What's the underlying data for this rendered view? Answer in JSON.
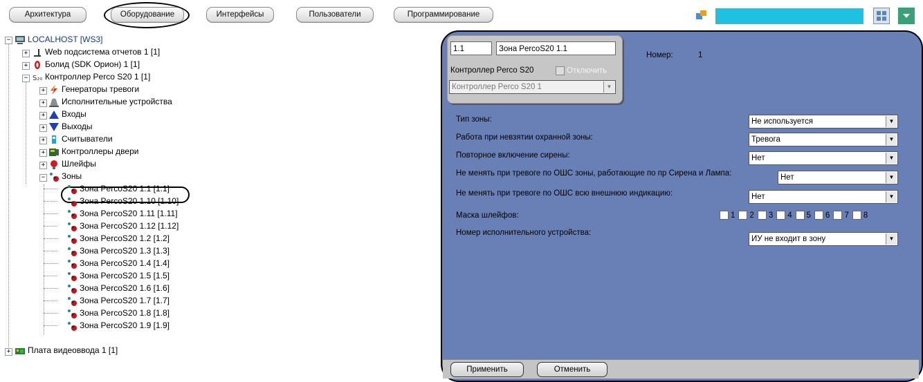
{
  "toolbar": {
    "tabs": [
      "Архитектура",
      "Оборудование",
      "Интерфейсы",
      "Пользователи",
      "Программирование"
    ]
  },
  "tree": {
    "root": "LOCALHOST [WS3]",
    "items": [
      {
        "label": "Web подсистема отчетов 1 [1]",
        "icon": "report-icon"
      },
      {
        "label": "Болид (SDK Орион) 1 [1]",
        "icon": "bolid-icon"
      },
      {
        "label": "Контроллер Perco S20 1 [1]",
        "icon": "controller-icon"
      },
      {
        "label": "Генераторы тревоги",
        "icon": "lightning-icon"
      },
      {
        "label": "Исполнительные устройства",
        "icon": "siren-icon"
      },
      {
        "label": "Входы",
        "icon": "input-icon"
      },
      {
        "label": "Выходы",
        "icon": "output-icon"
      },
      {
        "label": "Считыватели",
        "icon": "reader-icon"
      },
      {
        "label": "Контроллеры двери",
        "icon": "door-controller-icon"
      },
      {
        "label": "Шлейфы",
        "icon": "loop-icon"
      },
      {
        "label": "Зоны",
        "icon": "zones-icon"
      }
    ],
    "zones": [
      "Зона PercoS20 1.1 [1.1]",
      "Зона PercoS20 1.10 [1.10]",
      "Зона PercoS20 1.11 [1.11]",
      "Зона PercoS20 1.12 [1.12]",
      "Зона PercoS20 1.2 [1.2]",
      "Зона PercoS20 1.3 [1.3]",
      "Зона PercoS20 1.4 [1.4]",
      "Зона PercoS20 1.5 [1.5]",
      "Зона PercoS20 1.6 [1.6]",
      "Зона PercoS20 1.7 [1.7]",
      "Зона PercoS20 1.8 [1.8]",
      "Зона PercoS20 1.9 [1.9]"
    ],
    "last": "Плата видеоввода 1 [1]"
  },
  "header": {
    "id_value": "1.1",
    "name_value": "Зона PercoS20 1.1",
    "number_label": "Номер:",
    "number_value": "1",
    "parent_label": "Контроллер Perco S20",
    "disable_label": "Отключить",
    "parent_select": "Контроллер Perco S20 1"
  },
  "settings": {
    "zone_type_label": "Тип зоны:",
    "zone_type_value": "Не используется",
    "unarmed_label": "Работа при невзятии охранной зоны:",
    "unarmed_value": "Тревога",
    "siren_label": "Повторное включение сирены:",
    "siren_value": "Нет",
    "no_change_siren_label": "Не менять при тревоге по ОШС зоны, работающие по пр Сирена и Лампа:",
    "no_change_siren_value": "Нет",
    "no_change_ind_label": "Не менять при тревоге по ОШС всю внешнюю индикацию:",
    "no_change_ind_value": "Нет",
    "loops_label": "Маска шлейфов:",
    "loops": [
      "1",
      "2",
      "3",
      "4",
      "5",
      "6",
      "7",
      "8"
    ],
    "device_label": "Номер исполнительного устройства:",
    "device_value": "ИУ не входит в зону"
  },
  "buttons": {
    "apply": "Применить",
    "cancel": "Отменить"
  }
}
